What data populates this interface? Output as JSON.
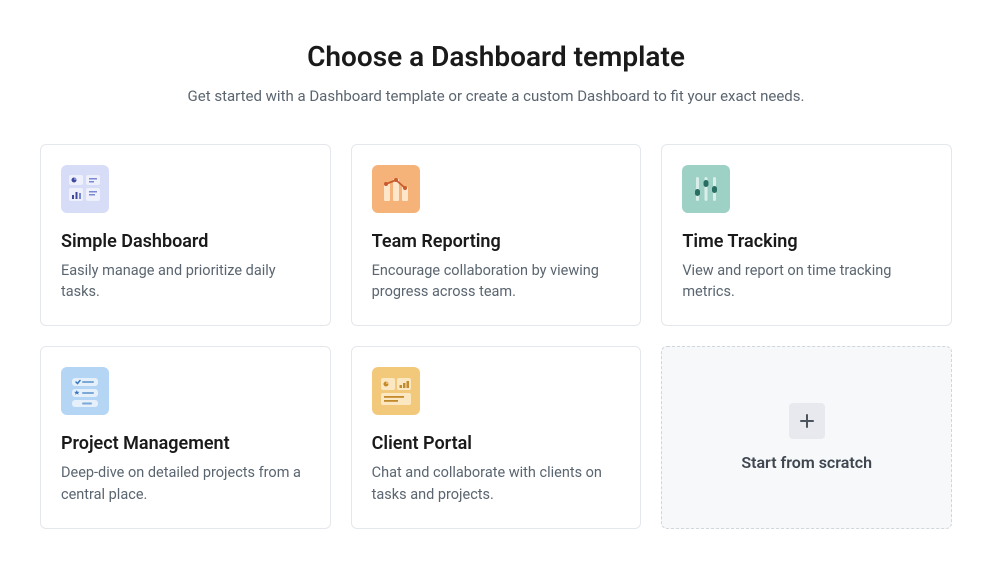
{
  "header": {
    "title": "Choose a Dashboard template",
    "subtitle": "Get started with a Dashboard template or create a custom Dashboard to fit your exact needs."
  },
  "templates": [
    {
      "id": "simple",
      "title": "Simple Dashboard",
      "description": "Easily manage and prioritize daily tasks.",
      "icon": "simple-dashboard-icon",
      "icon_bg": "#d7ddf7"
    },
    {
      "id": "team",
      "title": "Team Reporting",
      "description": "Encourage collaboration by viewing progress across team.",
      "icon": "team-reporting-icon",
      "icon_bg": "#f5b37a"
    },
    {
      "id": "time",
      "title": "Time Tracking",
      "description": "View and report on time tracking metrics.",
      "icon": "time-tracking-icon",
      "icon_bg": "#9ed1c5"
    },
    {
      "id": "project",
      "title": "Project Management",
      "description": "Deep-dive on detailed projects from a central place.",
      "icon": "project-management-icon",
      "icon_bg": "#b5d5f5"
    },
    {
      "id": "client",
      "title": "Client Portal",
      "description": "Chat and collaborate with clients on tasks and projects.",
      "icon": "client-portal-icon",
      "icon_bg": "#f2c97b"
    }
  ],
  "scratch": {
    "label": "Start from scratch",
    "icon": "plus-icon"
  }
}
